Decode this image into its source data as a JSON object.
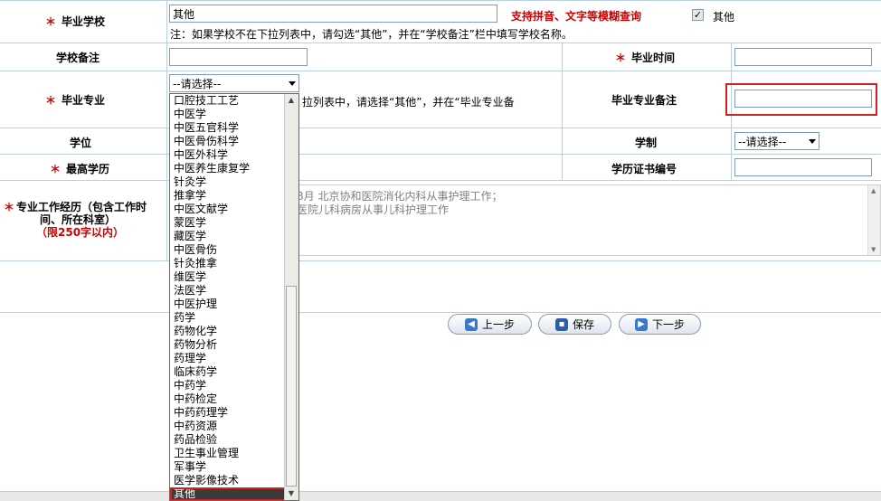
{
  "rows": {
    "school": {
      "label": "毕业学校",
      "value": "其他",
      "hint": "支持拼音、文字等模糊查询",
      "checkbox_label": "其他",
      "note": "注：如果学校不在下拉列表中，请勾选“其他”，并在“学校备注”栏中填写学校名称。"
    },
    "school_remark": {
      "label": "学校备注"
    },
    "grad_time": {
      "label": "毕业时间"
    },
    "major": {
      "label": "毕业专业",
      "select_value": "--请选择--",
      "note": "拉列表中，请选择“其他”，并在“毕业专业备"
    },
    "major_remark": {
      "label": "毕业专业备注"
    },
    "degree": {
      "label": "学位"
    },
    "schooling": {
      "label": "学制",
      "select_value": "--请选择--"
    },
    "education": {
      "label": "最高学历"
    },
    "cert_no": {
      "label": "学历证书编号"
    },
    "experience": {
      "label_line1": "专业工作经历（包含工作时",
      "label_line2": "间、所在科室）",
      "limit": "（限250字以内）",
      "text_line1": "8月  北京协和医院消化内科从事护理工作；",
      "text_line2": "医院儿科病房从事儿科护理工作"
    }
  },
  "buttons": {
    "prev": "上一步",
    "save": "保存",
    "next": "下一步"
  },
  "dropdown": {
    "options": [
      "口腔技工工艺",
      "中医学",
      "中医五官科学",
      "中医骨伤科学",
      "中医外科学",
      "中医养生康复学",
      "针灸学",
      "推拿学",
      "中医文献学",
      "蒙医学",
      "藏医学",
      "中医骨伤",
      "针灸推拿",
      "维医学",
      "法医学",
      "中医护理",
      "药学",
      "药物化学",
      "药物分析",
      "药理学",
      "临床药学",
      "中药学",
      "中药检定",
      "中药药理学",
      "中药资源",
      "药品检验",
      "卫生事业管理",
      "军事学",
      "医学影像技术",
      "其他"
    ],
    "selected": "其他"
  },
  "colors": {
    "required": "#cc0000",
    "hint": "#cc0000",
    "border": "#b9cfe4",
    "highlight": "#cc2222"
  }
}
